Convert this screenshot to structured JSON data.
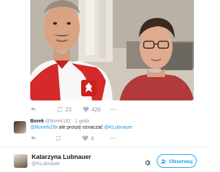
{
  "tweet": {
    "photo_alt": "Two men selfie",
    "retweet_count": "23",
    "like_count": "426"
  },
  "reply": {
    "name": "Borek",
    "handle": "@Borek182",
    "separator": "·",
    "time": "1 godz.",
    "mention1": "@BoniekZibi",
    "text_middle": " ale proszę oznaczać ",
    "mention2": "@KLubnauer",
    "like_count": "4"
  },
  "profile": {
    "name": "Katarzyna Lubnauer",
    "handle": "@KLubnauer",
    "follow_label": "Obserwuj"
  },
  "colors": {
    "link": "#1b95e0",
    "follow_blue": "#1da1f2",
    "muted": "#8899a6"
  },
  "icons": [
    "reply-icon",
    "retweet-icon",
    "heart-icon",
    "more-icon",
    "gear-icon",
    "follow-icon"
  ]
}
